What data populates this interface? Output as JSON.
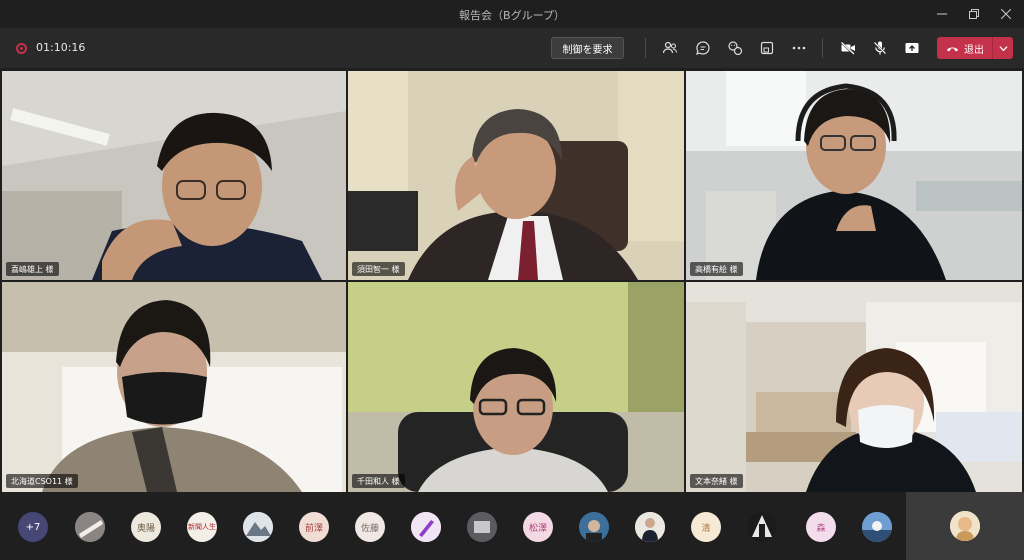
{
  "window": {
    "title": "報告会（Bグループ）",
    "controls": [
      "minimize",
      "maximize",
      "close"
    ]
  },
  "toolbar": {
    "recording_time": "01:10:16",
    "request_control_label": "制御を要求",
    "leave_label": "退出",
    "icons": [
      "people-icon",
      "chat-icon",
      "reactions-icon",
      "rooms-icon",
      "more-icon",
      "camera-off-icon",
      "mic-off-icon",
      "share-icon"
    ]
  },
  "participants": [
    {
      "name": "喜嶋雄上 様"
    },
    {
      "name": "須田智一 様"
    },
    {
      "name": "高橋有絵 様"
    },
    {
      "name": "北海道CSO11 様"
    },
    {
      "name": "千田和人 様"
    },
    {
      "name": "文本奈緒 様"
    }
  ],
  "strip": {
    "more_count": "+7",
    "avatar_texts": [
      "",
      "奥陽",
      "新聞人生",
      "",
      "前澤",
      "佐藤",
      "",
      "",
      "松澤",
      "",
      "",
      "清",
      "",
      "森",
      ""
    ]
  },
  "colors": {
    "accent": "#464775",
    "leave": "#c4314b",
    "toolbar_bg": "#292929",
    "app_bg": "#1f1f1f"
  }
}
